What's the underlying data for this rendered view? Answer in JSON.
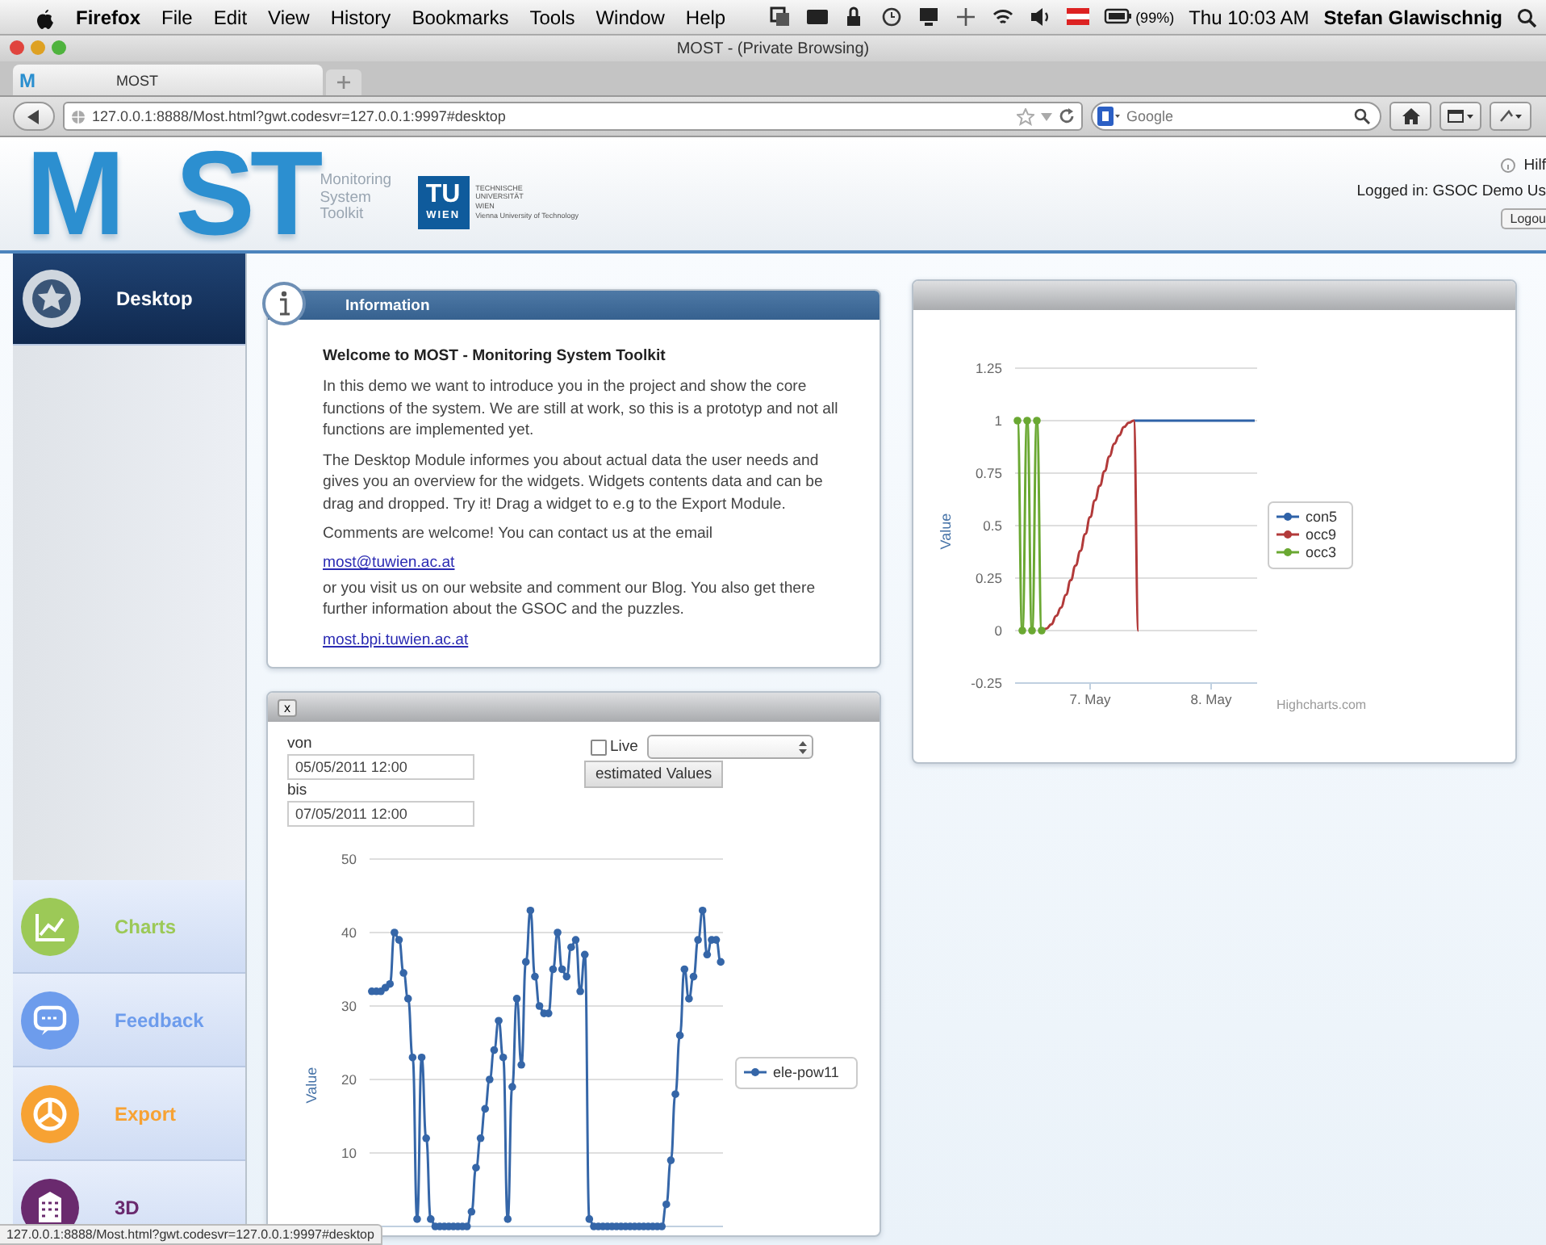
{
  "menubar": {
    "app": "Firefox",
    "menus": [
      "File",
      "Edit",
      "View",
      "History",
      "Bookmarks",
      "Tools",
      "Window",
      "Help"
    ],
    "battery": "(99%)",
    "clock": "Thu 10:03 AM",
    "user": "Stefan Glawischnig"
  },
  "window": {
    "title": "MOST - (Private Browsing)"
  },
  "tabs": [
    {
      "favicon": "M",
      "label": "MOST",
      "selected": true
    }
  ],
  "address_bar": {
    "url": "127.0.0.1:8888/Most.html?gwt.codesvr=127.0.0.1:9997#desktop",
    "search_placeholder": "Google"
  },
  "header": {
    "logo_left": "M",
    "logo_right": "ST",
    "logo_subtitle": [
      "Monitoring",
      "System",
      "Toolkit"
    ],
    "university": {
      "badge_top": "TU",
      "badge_bottom": "WIEN",
      "lines": [
        "TECHNISCHE",
        "UNIVERSITÄT",
        "WIEN",
        "Vienna University of Technology"
      ]
    },
    "help": "Hilf",
    "logged_in": "Logged in: GSOC Demo Us",
    "logout": "Logou"
  },
  "sidebar": {
    "items": [
      {
        "kind": "desktop",
        "label": "Desktop",
        "selected": true,
        "color": "#cfd6de"
      },
      {
        "kind": "charts",
        "label": "Charts",
        "selected": false,
        "color": "#9cc957"
      },
      {
        "kind": "feedback",
        "label": "Feedback",
        "selected": false,
        "color": "#6d9cec"
      },
      {
        "kind": "export",
        "label": "Export",
        "selected": false,
        "color": "#f7a233"
      },
      {
        "kind": "threed",
        "label": "3D",
        "selected": false,
        "color": "#6a2a6e"
      }
    ]
  },
  "info_panel": {
    "title": "Information",
    "content": [
      {
        "kind": "heading",
        "text": "Welcome to MOST - Monitoring System Toolkit"
      },
      {
        "kind": "text",
        "text": "In this demo we want to introduce you in the project and show the core functions of the system. We are still at work, so this is a prototyp and not all functions are implemented yet."
      },
      {
        "kind": "text",
        "text": "The Desktop Module informes you about actual data the user needs and gives you an overview for the widgets. Widgets contents data and can be drag and dropped. Try it! Drag a widget to e.g to the Export Module."
      },
      {
        "kind": "text",
        "text": "Comments are welcome! You can contact us at the email"
      },
      {
        "kind": "link",
        "text": "most@tuwien.ac.at"
      },
      {
        "kind": "text",
        "text": "or you visit us on our website and comment our Blog. You also get there further information about the GSOC and the puzzles."
      },
      {
        "kind": "link",
        "text": "most.bpi.tuwien.ac.at"
      }
    ]
  },
  "chart_widget": {
    "credits": "Highcharts.com",
    "chart_data": {
      "type": "line",
      "ylabel": "Value",
      "grid": true,
      "legend": "right",
      "categories": [
        null,
        null,
        null,
        null,
        null,
        null,
        null,
        null,
        null,
        null,
        null,
        null,
        null,
        null,
        null,
        "7. May",
        null,
        null,
        null,
        null,
        null,
        null,
        null,
        null,
        null,
        null,
        null,
        null,
        null,
        null,
        null,
        null,
        null,
        null,
        null,
        null,
        null,
        null,
        null,
        null,
        "8. May",
        null,
        null,
        null,
        null,
        null,
        null,
        null,
        null,
        null
      ],
      "ylim": [
        -0.25,
        1.25
      ],
      "yticks": [
        -0.25,
        0,
        0.25,
        0.5,
        0.75,
        1,
        1.25
      ],
      "series": [
        {
          "name": "con5",
          "color": "#2f62a8",
          "marker": false,
          "values": [
            null,
            null,
            null,
            null,
            null,
            null,
            null,
            null,
            null,
            null,
            null,
            null,
            null,
            null,
            null,
            null,
            null,
            null,
            null,
            null,
            null,
            null,
            null,
            null,
            1,
            1,
            1,
            1,
            1,
            1,
            1,
            1,
            1,
            1,
            1,
            1,
            1,
            1,
            1,
            1,
            1,
            1,
            1,
            1,
            1,
            1,
            1,
            1,
            1,
            1
          ]
        },
        {
          "name": "occ9",
          "color": "#b23a3a",
          "marker": false,
          "values": [
            null,
            null,
            null,
            null,
            null,
            0,
            0.01,
            0.03,
            0.07,
            0.11,
            0.17,
            0.24,
            0.31,
            0.38,
            0.46,
            0.54,
            0.62,
            0.69,
            0.76,
            0.83,
            0.89,
            0.93,
            0.97,
            0.99,
            1,
            0,
            null,
            null,
            null,
            null,
            null,
            null,
            null,
            null,
            null,
            null,
            null,
            null,
            null,
            null,
            null,
            null,
            null,
            null,
            null,
            null,
            null,
            null,
            null,
            null
          ]
        },
        {
          "name": "occ3",
          "color": "#6aa832",
          "marker": true,
          "values": [
            1,
            0,
            1,
            0,
            1,
            0,
            null,
            null,
            null,
            null,
            null,
            null,
            null,
            null,
            null,
            null,
            null,
            null,
            null,
            null,
            null,
            null,
            null,
            null,
            null,
            null,
            null,
            null,
            null,
            null,
            null,
            null,
            null,
            null,
            null,
            null,
            null,
            null,
            null,
            null,
            null,
            null,
            null,
            null,
            null,
            null,
            null,
            null,
            null,
            null
          ]
        }
      ]
    }
  },
  "range_widget": {
    "close": "x",
    "from_label": "von",
    "from_value": "05/05/2011 12:00",
    "to_label": "bis",
    "to_value": "07/05/2011 12:00",
    "live": {
      "label": "Live",
      "checked": false
    },
    "button": "estimated Values",
    "chart_data": {
      "type": "line",
      "ylabel": "Value",
      "grid": true,
      "legend": "right",
      "ylim": [
        0,
        50
      ],
      "yticks": [
        10,
        20,
        30,
        40,
        50
      ],
      "series": [
        {
          "name": "ele-pow11",
          "color": "#3566a8",
          "marker": true,
          "values": [
            32,
            32,
            32,
            32.5,
            33,
            40,
            39,
            34.5,
            31,
            23,
            1,
            23,
            12,
            1,
            0,
            0,
            0,
            0,
            0,
            0,
            0,
            0,
            2,
            8,
            12,
            16,
            20,
            24,
            28,
            23,
            1,
            19,
            31,
            22,
            36,
            43,
            34,
            30,
            29,
            29,
            35,
            40,
            35,
            34,
            38,
            39,
            32,
            37,
            1,
            0,
            0,
            0,
            0,
            0,
            0,
            0,
            0,
            0,
            0,
            0,
            0,
            0,
            0,
            0,
            0,
            3,
            9,
            18,
            26,
            35,
            31,
            34,
            39,
            43,
            37,
            39,
            39,
            36
          ]
        }
      ]
    }
  },
  "status_bar": {
    "url": "127.0.0.1:8888/Most.html?gwt.codesvr=127.0.0.1:9997#desktop"
  }
}
